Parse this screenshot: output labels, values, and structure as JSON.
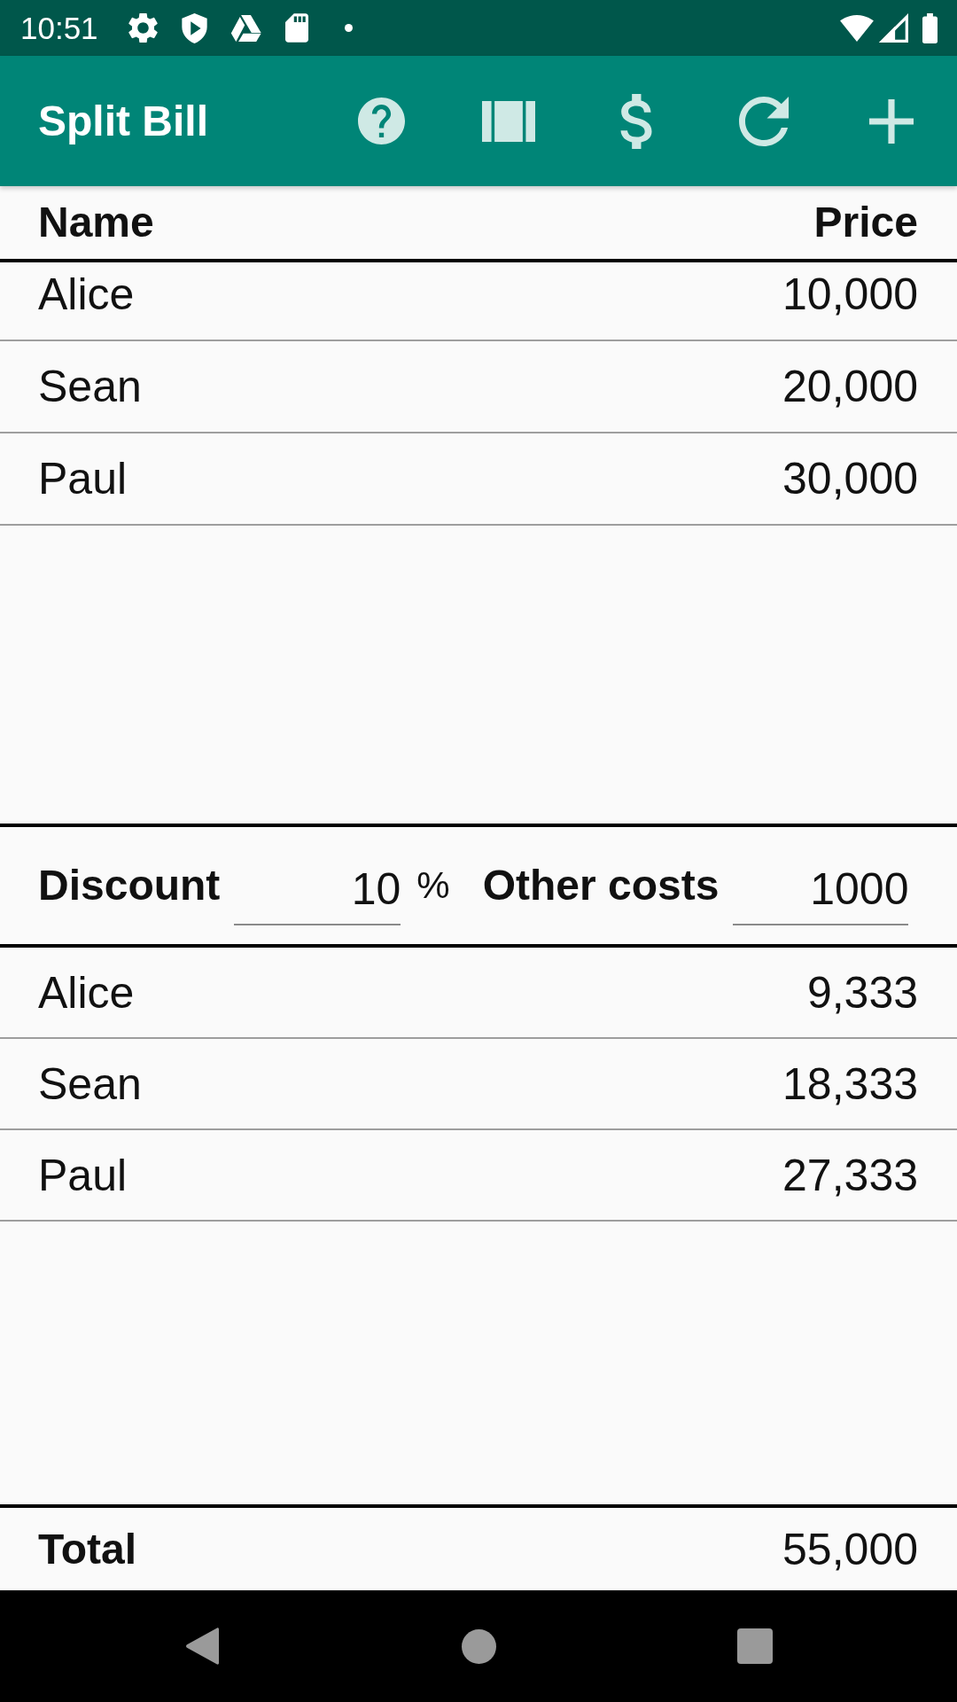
{
  "status_bar": {
    "time": "10:51"
  },
  "app_bar": {
    "title": "Split Bill"
  },
  "items": {
    "columns": [
      "Name",
      "Price"
    ],
    "rows": [
      {
        "name": "Alice",
        "price": "10,000"
      },
      {
        "name": "Sean",
        "price": "20,000"
      },
      {
        "name": "Paul",
        "price": "30,000"
      }
    ]
  },
  "adjustments": [
    {
      "label": "Discount",
      "value": "10",
      "unit": "%"
    },
    {
      "label": "Other costs",
      "value": "1000"
    }
  ],
  "shares": [
    {
      "name": "Alice",
      "amount": "9,333"
    },
    {
      "name": "Sean",
      "amount": "18,333"
    },
    {
      "name": "Paul",
      "amount": "27,333"
    }
  ],
  "total": {
    "label": "Total",
    "amount": "55,000"
  }
}
